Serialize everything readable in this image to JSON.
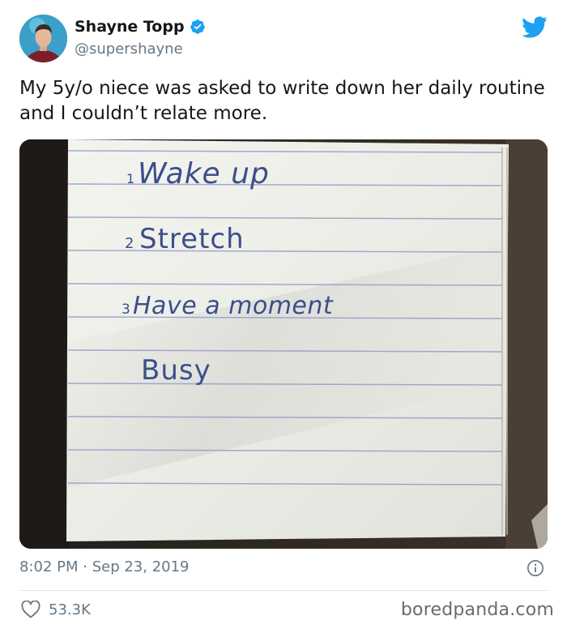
{
  "tweet": {
    "author": {
      "display_name": "Shayne Topp",
      "handle": "@supershayne",
      "verified_icon": "verified-badge-icon",
      "avatar_icon": "avatar"
    },
    "text": "My 5y/o niece was asked to write down her daily routine and I couldn’t relate more.",
    "media": {
      "notebook_lines": [
        {
          "number": "1",
          "text": "Wake up"
        },
        {
          "number": "2",
          "text": "Stretch"
        },
        {
          "number": "3",
          "text": "Have a moment"
        },
        {
          "number": "",
          "text": "Busy"
        }
      ]
    },
    "timestamp": "8:02 PM · Sep 23, 2019",
    "likes": "53.3K"
  },
  "brand_colors": {
    "twitter_blue": "#1da1f2",
    "text_primary": "#14171a",
    "text_secondary": "#657786",
    "ink_blue": "#3b4f8a"
  },
  "watermark": "boredpanda.com"
}
